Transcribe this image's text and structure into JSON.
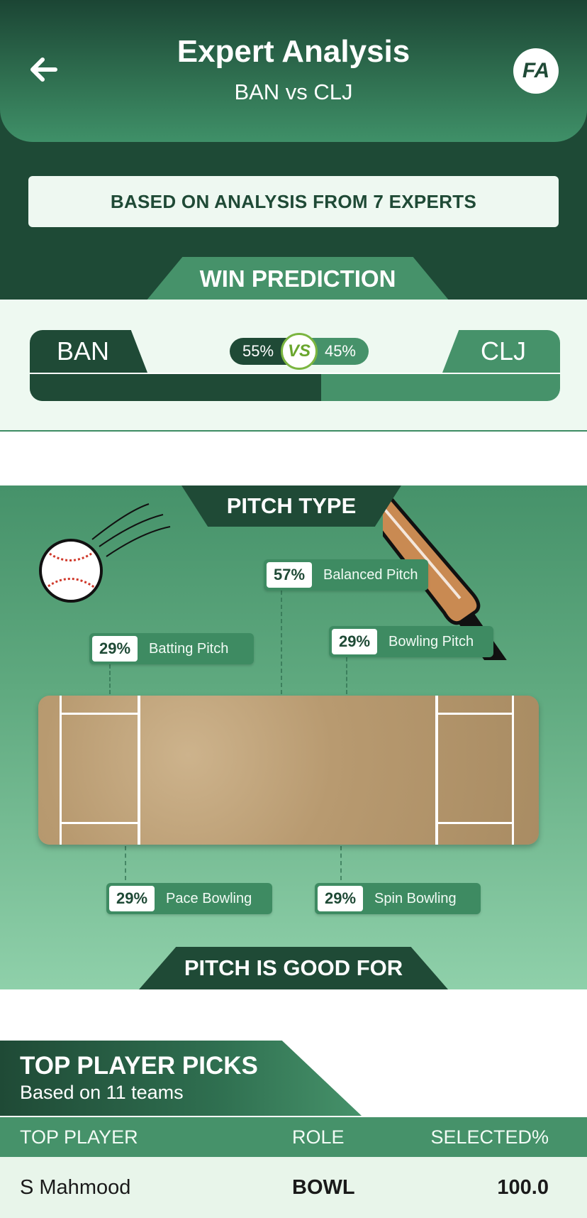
{
  "header": {
    "title": "Expert Analysis",
    "subtitle": "BAN vs CLJ",
    "logo_text": "FA",
    "back_icon": "arrow-left-icon"
  },
  "experts_banner": "BASED ON ANALYSIS FROM 7 EXPERTS",
  "win_prediction": {
    "heading": "WIN PREDICTION",
    "team_a": "BAN",
    "team_b": "CLJ",
    "team_a_pct_label": "55%",
    "team_b_pct_label": "45%",
    "team_a_share": 0.55,
    "vs_label": "VS",
    "colors": {
      "team_a": "#1f4a36",
      "team_b": "#46926a",
      "vs_ring": "#7bb540"
    }
  },
  "pitch_type": {
    "heading": "PITCH TYPE",
    "stats": [
      {
        "key": "balanced",
        "pct": "57%",
        "label": "Balanced Pitch"
      },
      {
        "key": "batting",
        "pct": "29%",
        "label": "Batting Pitch"
      },
      {
        "key": "bowling",
        "pct": "29%",
        "label": "Bowling Pitch"
      },
      {
        "key": "pace",
        "pct": "29%",
        "label": "Pace Bowling"
      },
      {
        "key": "spin",
        "pct": "29%",
        "label": "Spin Bowling"
      }
    ]
  },
  "pitch_good_for": {
    "heading": "PITCH IS GOOD FOR"
  },
  "top_picks": {
    "title": "TOP PLAYER PICKS",
    "subtitle": "Based on 11 teams",
    "columns": [
      "TOP PLAYER",
      "ROLE",
      "SELECTED%"
    ],
    "rows": [
      {
        "player": "S Mahmood",
        "role": "BOWL",
        "selected": "100.0"
      }
    ]
  }
}
